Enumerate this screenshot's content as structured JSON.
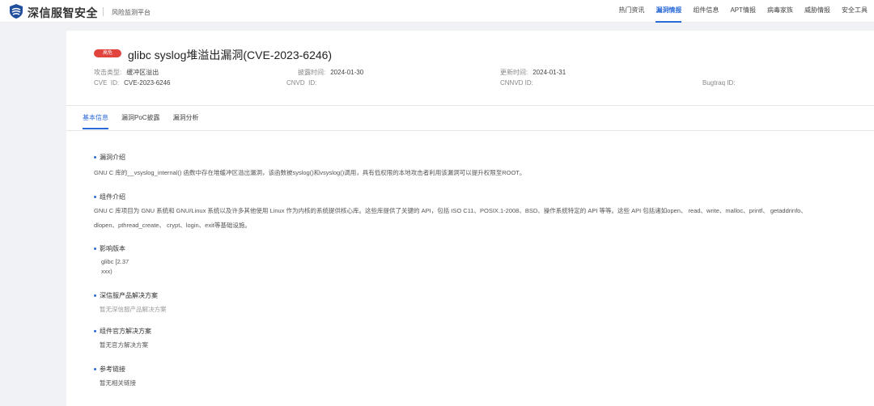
{
  "brand": {
    "name": "深信服智安全",
    "subtitle": "风险监测平台"
  },
  "nav": [
    "热门资讯",
    "漏洞情报",
    "组件信息",
    "APT情报",
    "病毒家族",
    "威胁情报",
    "安全工具"
  ],
  "nav_active": "漏洞情报",
  "vuln": {
    "badge": "高危",
    "title": "glibc syslog堆溢出漏洞(CVE-2023-6246)",
    "attack_type_label": "攻击类型:",
    "attack_type": "缓冲区溢出",
    "disclosed_label": "披露时间:",
    "disclosed": "2024-01-30",
    "updated_label": "更新时间:",
    "updated": "2024-01-31",
    "cve_label": "CVE  ID:",
    "cve": "CVE-2023-6246",
    "cnvd_label": "CNVD  ID:",
    "cnvd": "",
    "cnnvd_label": "CNNVD ID:",
    "cnnvd": "",
    "bugtraq_label": "Bugtraq ID:",
    "bugtraq": ""
  },
  "tabs": [
    "基本信息",
    "漏洞PoC披露",
    "漏洞分析"
  ],
  "sections": {
    "intro_title": "漏洞介绍",
    "intro_text": "GNU C 库的__vsyslog_internal() 函数中存在堆缓冲区溢出漏洞，该函数被syslog()和vsyslog()调用，具有低权限的本地攻击者利用该漏洞可以提升权限至ROOT。",
    "component_title": "组件介绍",
    "component_text_1": "GNU C 库项目为 GNU 系统和 GNU/Linux 系统以及许多其他使用 Linux 作为内核的系统提供核心库。这些库提供了关键的 API，包括 ISO C11、POSIX.1-2008、BSD、操作系统特定的 API 等等。这些 API 包括诸如open、 read、write、malloc、printf、 getaddrinfo、",
    "component_text_2": "dlopen、pthread_create、 crypt、login、exit等基础设施。",
    "affected_title": "影响版本",
    "affected_line_1": "glibc [2.37",
    "affected_line_2": "xxx)",
    "vendor_solution_title": "深信服产品解决方案",
    "vendor_solution_text": "暂无深信服产品解决方案",
    "official_solution_title": "组件官方解决方案",
    "official_solution_text": "暂无官方解决方案",
    "refs_title": "参考链接",
    "refs_text": "暂无相关链接"
  },
  "colors": {
    "accent": "#2b6bd8",
    "danger": "#e0443d"
  }
}
